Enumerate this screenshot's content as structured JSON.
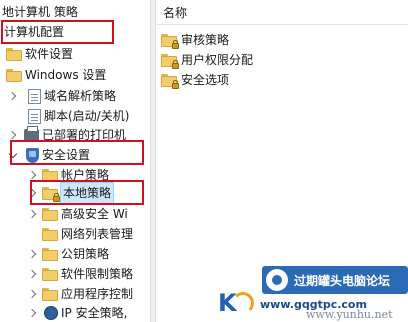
{
  "tree": {
    "root_partial": "地计算机 策略",
    "computer_config": "计算机配置",
    "software_settings": "软件设置",
    "windows_settings": "Windows 设置",
    "dns_policy": "域名解析策略",
    "scripts": "脚本(启动/关机)",
    "printers": "已部署的打印机",
    "security_settings": "安全设置",
    "account_policy": "帐户策略",
    "local_policy": "本地策略",
    "advanced_security": "高级安全 Wi",
    "network_list": "网络列表管理",
    "public_key": "公钥策略",
    "software_restriction": "软件限制策略",
    "app_control": "应用程序控制",
    "ip_security": "IP 安全策略,"
  },
  "list": {
    "column_name": "名称",
    "items": [
      "审核策略",
      "用户权限分配",
      "安全选项"
    ]
  },
  "watermark": {
    "forum": "过期罐头电脑论坛",
    "url1": "www.gqgtpc.com",
    "url2": "www.yunhu.net"
  },
  "colors": {
    "highlight_box": "#d01020",
    "folder": "#f2cd6a",
    "watermark_blue": "#2b6bb5"
  }
}
